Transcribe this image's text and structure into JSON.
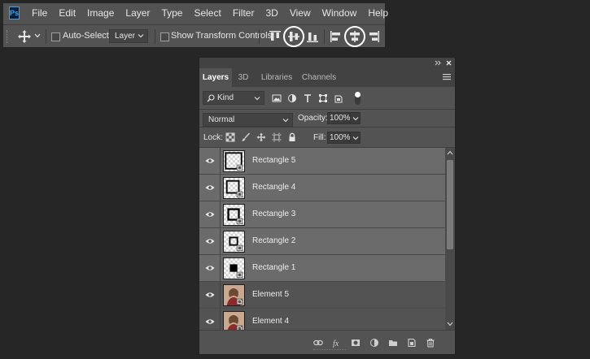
{
  "app": {
    "logo_text": "Ps",
    "menu": [
      "File",
      "Edit",
      "Image",
      "Layer",
      "Type",
      "Select",
      "Filter",
      "3D",
      "View",
      "Window",
      "Help"
    ]
  },
  "options_bar": {
    "auto_select_label": "Auto-Select:",
    "auto_select_checked": false,
    "auto_select_target": "Layer",
    "show_transform_label": "Show Transform Controls",
    "show_transform_checked": false,
    "highlighted_buttons": [
      "align-vertical-centers",
      "align-horizontal-centers"
    ]
  },
  "layers_panel": {
    "tabs": [
      {
        "label": "Layers",
        "active": true
      },
      {
        "label": "3D",
        "active": false
      },
      {
        "label": "Libraries",
        "active": false
      },
      {
        "label": "Channels",
        "active": false
      }
    ],
    "filter_kind": "Kind",
    "blend_mode": "Normal",
    "opacity_label": "Opacity:",
    "opacity_value": "100%",
    "lock_label": "Lock:",
    "fill_label": "Fill:",
    "fill_value": "100%",
    "layers": [
      {
        "name": "Rectangle 5",
        "selected": true,
        "thumb": "rect5"
      },
      {
        "name": "Rectangle 4",
        "selected": true,
        "thumb": "rect4"
      },
      {
        "name": "Rectangle 3",
        "selected": true,
        "thumb": "rect3"
      },
      {
        "name": "Rectangle 2",
        "selected": true,
        "thumb": "rect2"
      },
      {
        "name": "Rectangle 1",
        "selected": true,
        "thumb": "rect1"
      },
      {
        "name": "Element 5",
        "selected": false,
        "thumb": "photo"
      },
      {
        "name": "Element 4",
        "selected": false,
        "thumb": "photo"
      }
    ]
  },
  "colors": {
    "app_background": "#262626",
    "panel_background": "#535353",
    "selected_layer": "#6b6b6b",
    "highlight_circle": "#ffffff",
    "ps_logo_blue": "#31a8ff"
  }
}
